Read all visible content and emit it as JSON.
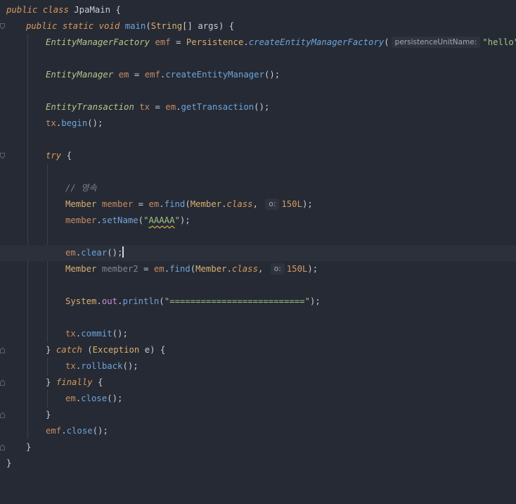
{
  "editor": {
    "lines": {
      "l1": {
        "kw1": "public",
        "kw2": "class",
        "name": "JpaMain",
        "brace": "{"
      },
      "l2": {
        "kw1": "public",
        "kw2": "static",
        "kw3": "void",
        "method": "main",
        "p1": "(",
        "type": "String",
        "p2": "[] args) {"
      },
      "l3": {
        "type": "EntityManagerFactory",
        "var": "emf",
        "eq": "=",
        "cls": "Persistence",
        "dot": ".",
        "method": "createEntityManagerFactory",
        "p1": "(",
        "hint": "persistenceUnitName:",
        "str": "\"hello\"",
        "p2": ");"
      },
      "l5": {
        "type": "EntityManager",
        "var": "em",
        "eq": "=",
        "obj": "emf",
        "dot": ".",
        "method": "createEntityManager",
        "p": "();"
      },
      "l7": {
        "type": "EntityTransaction",
        "var": "tx",
        "eq": "=",
        "obj": "em",
        "dot": ".",
        "method": "getTransaction",
        "p": "();"
      },
      "l8": {
        "obj": "tx",
        "dot": ".",
        "method": "begin",
        "p": "();"
      },
      "l10": {
        "kw": "try",
        "brace": "{"
      },
      "l12": {
        "comment": "// 영속"
      },
      "l13": {
        "type": "Member",
        "var": "member",
        "eq": "=",
        "obj": "em",
        "dot": ".",
        "method": "find",
        "p1": "(",
        "cls": "Member",
        "dot2": ".",
        "kw": "class",
        "comma": ",",
        "hint": "o:",
        "num": "150L",
        "p2": ");"
      },
      "l14": {
        "obj": "member",
        "dot": ".",
        "method": "setName",
        "p1": "(",
        "q1": "\"",
        "strval": "AAAAA",
        "q2": "\"",
        "p2": ");"
      },
      "l16": {
        "obj": "em",
        "dot": ".",
        "method": "clear",
        "p1": "();"
      },
      "l17": {
        "type": "Member",
        "var": "member2",
        "eq": "=",
        "obj": "em",
        "dot": ".",
        "method": "find",
        "p1": "(",
        "cls": "Member",
        "dot2": ".",
        "kw": "class",
        "comma": ",",
        "hint": "o:",
        "num": "150L",
        "p2": ");"
      },
      "l19": {
        "cls": "System",
        "dot": ".",
        "field": "out",
        "dot2": ".",
        "method": "println",
        "p1": "(",
        "str": "\"==========================\"",
        "p2": ");"
      },
      "l21": {
        "obj": "tx",
        "dot": ".",
        "method": "commit",
        "p": "();"
      },
      "l22": {
        "b1": "}",
        "kw": "catch",
        "p1": "(",
        "type": "Exception",
        "p2": "e) {"
      },
      "l23": {
        "obj": "tx",
        "dot": ".",
        "method": "rollback",
        "p": "();"
      },
      "l24": {
        "b1": "}",
        "kw": "finally",
        "brace": "{"
      },
      "l25": {
        "obj": "em",
        "dot": ".",
        "method": "close",
        "p": "();"
      },
      "l26": {
        "b": "}"
      },
      "l27": {
        "obj": "emf",
        "dot": ".",
        "method": "close",
        "p": "();"
      },
      "l28": {
        "b": "}"
      },
      "l29": {
        "b": "}"
      }
    }
  },
  "colors": {
    "background": "#262a34",
    "keyword": "#d89a5c",
    "method": "#6ea4d8",
    "string": "#a3c385",
    "number": "#d49b66"
  }
}
